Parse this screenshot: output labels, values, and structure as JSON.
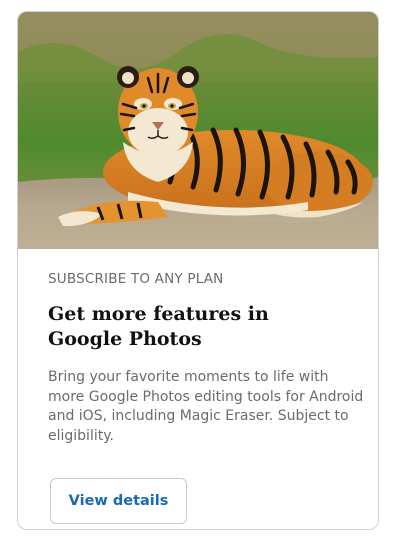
{
  "card": {
    "image_subject": "tiger",
    "eyebrow": "SUBSCRIBE TO ANY PLAN",
    "title": "Get more features in Google Photos",
    "description": "Bring your favorite moments to life with more Google Photos editing tools for Android and iOS, including Magic Eraser. Subject to eligibility.",
    "button_label": "View details"
  },
  "colors": {
    "button_text": "#1a6ab3",
    "muted_text": "#6b6b6b",
    "title_text": "#111111",
    "border": "#d2d2d2"
  }
}
